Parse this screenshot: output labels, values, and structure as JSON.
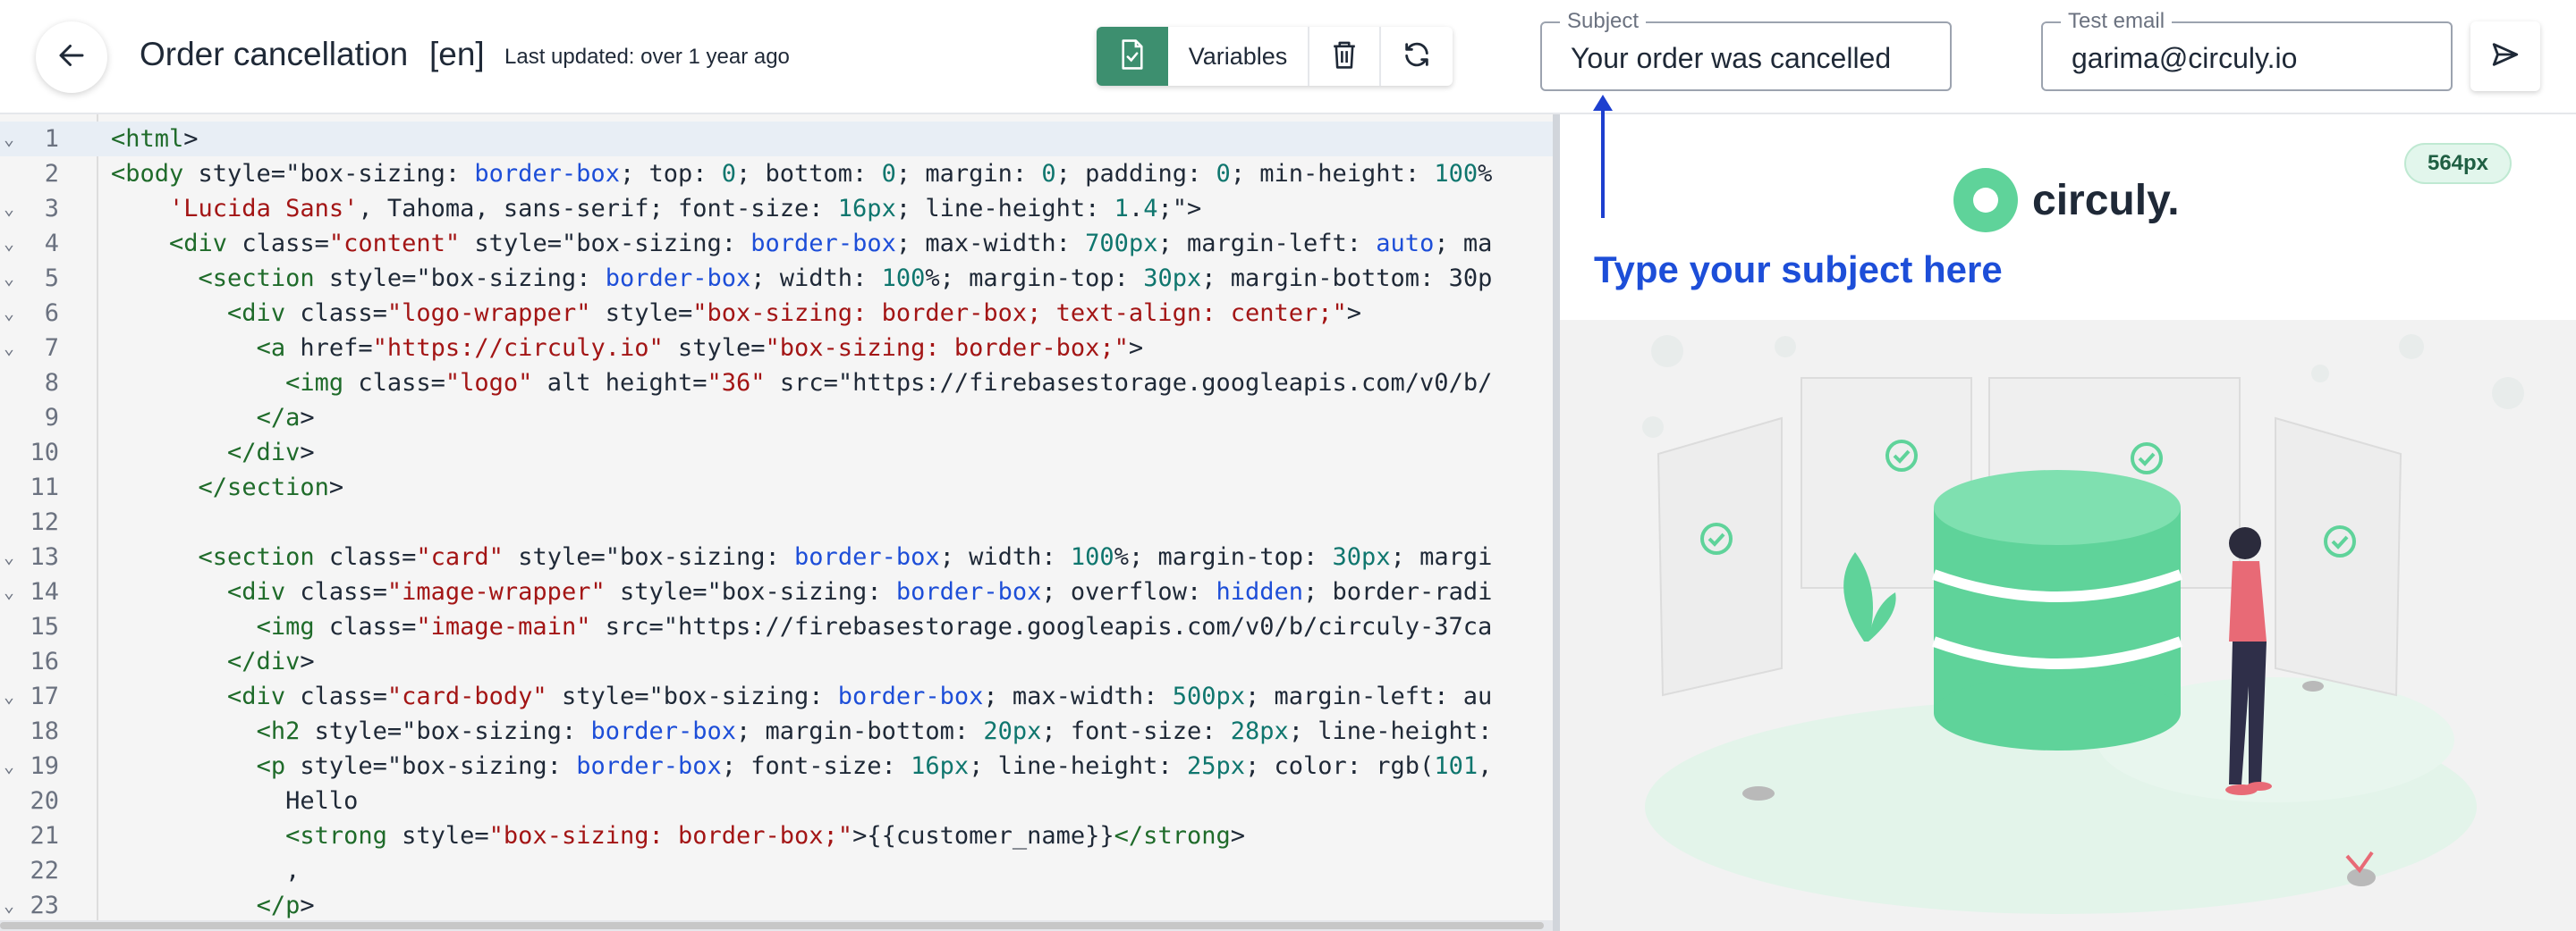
{
  "header": {
    "back_icon": "arrow-left-icon",
    "title": "Order cancellation",
    "language": "[en]",
    "last_updated": "Last updated: over 1 year ago",
    "toolbar": {
      "validate_icon": "file-check-icon",
      "variables_label": "Variables",
      "delete_icon": "trash-icon",
      "refresh_icon": "refresh-icon"
    },
    "subject": {
      "label": "Subject",
      "value": "Your order was cancelled"
    },
    "test_email": {
      "label": "Test email",
      "value": "garima@circuly.io"
    },
    "send_icon": "send-icon"
  },
  "editor": {
    "lines": [
      {
        "n": "1",
        "fold": true,
        "code": "<html>"
      },
      {
        "n": "2",
        "fold": false,
        "code": "<body style=\"box-sizing: border-box; top: 0; bottom: 0; margin: 0; padding: 0; min-height: 100%"
      },
      {
        "n": "3",
        "fold": true,
        "code": "    'Lucida Sans', Tahoma, sans-serif; font-size: 16px; line-height: 1.4;\">"
      },
      {
        "n": "4",
        "fold": true,
        "code": "    <div class=\"content\" style=\"box-sizing: border-box; max-width: 700px; margin-left: auto; ma"
      },
      {
        "n": "5",
        "fold": true,
        "code": "      <section style=\"box-sizing: border-box; width: 100%; margin-top: 30px; margin-bottom: 30p"
      },
      {
        "n": "6",
        "fold": true,
        "code": "        <div class=\"logo-wrapper\" style=\"box-sizing: border-box; text-align: center;\">"
      },
      {
        "n": "7",
        "fold": true,
        "code": "          <a href=\"https://circuly.io\" style=\"box-sizing: border-box;\">"
      },
      {
        "n": "8",
        "fold": false,
        "code": "            <img class=\"logo\" alt height=\"36\" src=\"https://firebasestorage.googleapis.com/v0/b/"
      },
      {
        "n": "9",
        "fold": false,
        "code": "          </a>"
      },
      {
        "n": "10",
        "fold": false,
        "code": "        </div>"
      },
      {
        "n": "11",
        "fold": false,
        "code": "      </section>"
      },
      {
        "n": "12",
        "fold": false,
        "code": ""
      },
      {
        "n": "13",
        "fold": true,
        "code": "      <section class=\"card\" style=\"box-sizing: border-box; width: 100%; margin-top: 30px; margi"
      },
      {
        "n": "14",
        "fold": true,
        "code": "        <div class=\"image-wrapper\" style=\"box-sizing: border-box; overflow: hidden; border-radi"
      },
      {
        "n": "15",
        "fold": false,
        "code": "          <img class=\"image-main\" src=\"https://firebasestorage.googleapis.com/v0/b/circuly-37ca"
      },
      {
        "n": "16",
        "fold": false,
        "code": "        </div>"
      },
      {
        "n": "17",
        "fold": true,
        "code": "        <div class=\"card-body\" style=\"box-sizing: border-box; max-width: 500px; margin-left: au"
      },
      {
        "n": "18",
        "fold": false,
        "code": "          <h2 style=\"box-sizing: border-box; margin-bottom: 20px; font-size: 28px; line-height:"
      },
      {
        "n": "19",
        "fold": true,
        "code": "          <p style=\"box-sizing: border-box; font-size: 16px; line-height: 25px; color: rgb(101,"
      },
      {
        "n": "20",
        "fold": false,
        "code": "            Hello"
      },
      {
        "n": "21",
        "fold": false,
        "code": "            <strong style=\"box-sizing: border-box;\">{{customer_name}}</strong>"
      },
      {
        "n": "22",
        "fold": false,
        "code": "            ,"
      },
      {
        "n": "23",
        "fold": true,
        "code": "          </p>"
      }
    ],
    "active_line": "1"
  },
  "preview": {
    "width_badge": "564px",
    "logo_text": "circuly.",
    "subject_placeholder": "Type your subject here",
    "illustration": "database-illustration",
    "colors": {
      "brand_green": "#5fd39a",
      "subject_blue": "#1d4ed8",
      "pointer_blue": "#1d3fcf"
    }
  }
}
